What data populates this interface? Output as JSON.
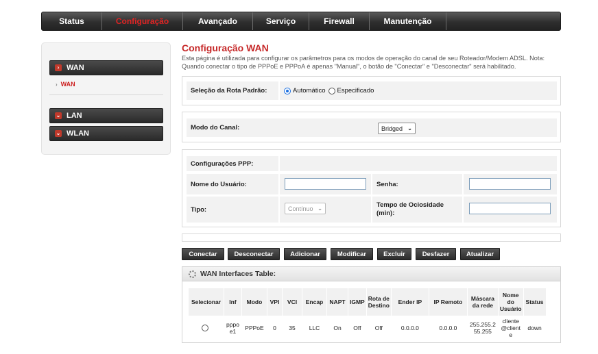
{
  "nav": {
    "items": [
      "Status",
      "Configuração",
      "Avançado",
      "Serviço",
      "Firewall",
      "Manutenção"
    ],
    "active_index": 1,
    "active_color": "#e02424"
  },
  "sidebar": {
    "groups": [
      {
        "label": "WAN",
        "icon": "chevron-right-icon",
        "expanded": true
      },
      {
        "label": "LAN",
        "icon": "chevron-down-icon"
      },
      {
        "label": "WLAN",
        "icon": "chevron-down-icon"
      }
    ],
    "sub_item": "WAN"
  },
  "page": {
    "title": "Configuração WAN",
    "description": "Esta página é utilizada para configurar os parâmetros para os modos de operação do canal de seu Roteador/Modem ADSL. Nota: Quando conectar o tipo de PPPoE e PPPoA é apenas \"Manual\", o botão de \"Conectar\" e \"Desconectar\" será habilitado."
  },
  "route": {
    "label": "Seleção da Rota Padrão:",
    "options": [
      "Automático",
      "Especificado"
    ],
    "selected": "Automático"
  },
  "channel": {
    "label": "Modo do Canal:",
    "value": "Bridged"
  },
  "ppp": {
    "section_label": "Configurações PPP:",
    "username_label": "Nome do Usuário:",
    "username_value": "",
    "password_label": "Senha:",
    "password_value": "",
    "type_label": "Tipo:",
    "type_value": "Contínuo",
    "idle_label": "Tempo de Ociosidade (min):",
    "idle_value": ""
  },
  "buttons": [
    "Conectar",
    "Desconectar",
    "Adicionar",
    "Modificar",
    "Excluir",
    "Desfazer",
    "Atualizar"
  ],
  "table": {
    "title": "WAN Interfaces Table:",
    "columns": [
      "Selecionar",
      "Inf",
      "Modo",
      "VPI",
      "VCI",
      "Encap",
      "NAPT",
      "IGMP",
      "Rota de Destino",
      "Ender IP",
      "IP Remoto",
      "Máscara da rede",
      "Nome do Usuário",
      "Status"
    ],
    "rows": [
      [
        "",
        "pppoe1",
        "PPPoE",
        "0",
        "35",
        "LLC",
        "On",
        "Off",
        "Off",
        "0.0.0.0",
        "0.0.0.0",
        "255.255.255.255",
        "cliente@cliente",
        "down"
      ]
    ]
  }
}
